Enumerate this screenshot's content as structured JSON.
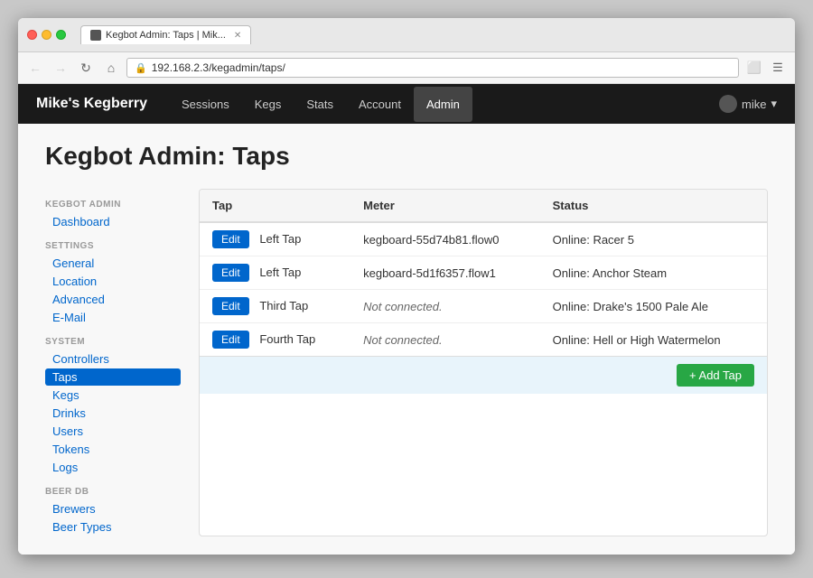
{
  "browser": {
    "tab_title": "Kegbot Admin: Taps | Mik...",
    "tab_favicon": "🍺",
    "url": "192.168.2.3/kegadmin/taps/",
    "nav_back": "←",
    "nav_forward": "→",
    "nav_refresh": "↻",
    "nav_home": "⌂"
  },
  "app": {
    "brand": "Mike's Kegberry",
    "nav_links": [
      {
        "label": "Sessions",
        "active": false
      },
      {
        "label": "Kegs",
        "active": false
      },
      {
        "label": "Stats",
        "active": false
      },
      {
        "label": "Account",
        "active": false
      },
      {
        "label": "Admin",
        "active": true
      }
    ],
    "user_label": "mike"
  },
  "page": {
    "title": "Kegbot Admin: Taps"
  },
  "sidebar": {
    "sections": [
      {
        "title": "KEGBOT ADMIN",
        "links": [
          {
            "label": "Dashboard",
            "active": false
          }
        ]
      },
      {
        "title": "SETTINGS",
        "links": [
          {
            "label": "General",
            "active": false
          },
          {
            "label": "Location",
            "active": false
          },
          {
            "label": "Advanced",
            "active": false
          },
          {
            "label": "E-Mail",
            "active": false
          }
        ]
      },
      {
        "title": "SYSTEM",
        "links": [
          {
            "label": "Controllers",
            "active": false
          },
          {
            "label": "Taps",
            "active": true
          },
          {
            "label": "Kegs",
            "active": false
          },
          {
            "label": "Drinks",
            "active": false
          },
          {
            "label": "Users",
            "active": false
          },
          {
            "label": "Tokens",
            "active": false
          },
          {
            "label": "Logs",
            "active": false
          }
        ]
      },
      {
        "title": "BEER DB",
        "links": [
          {
            "label": "Brewers",
            "active": false
          },
          {
            "label": "Beer Types",
            "active": false
          }
        ]
      }
    ]
  },
  "table": {
    "columns": [
      "Tap",
      "Meter",
      "Status"
    ],
    "rows": [
      {
        "edit_label": "Edit",
        "tap": "Left Tap",
        "meter": "kegboard-55d74b81.flow0",
        "meter_italic": false,
        "status": "Online: Racer 5"
      },
      {
        "edit_label": "Edit",
        "tap": "Left Tap",
        "meter": "kegboard-5d1f6357.flow1",
        "meter_italic": false,
        "status": "Online: Anchor Steam"
      },
      {
        "edit_label": "Edit",
        "tap": "Third Tap",
        "meter": "Not connected.",
        "meter_italic": true,
        "status": "Online: Drake's 1500 Pale Ale"
      },
      {
        "edit_label": "Edit",
        "tap": "Fourth Tap",
        "meter": "Not connected.",
        "meter_italic": true,
        "status": "Online: Hell or High Watermelon"
      }
    ],
    "add_tap_label": "+ Add Tap"
  }
}
